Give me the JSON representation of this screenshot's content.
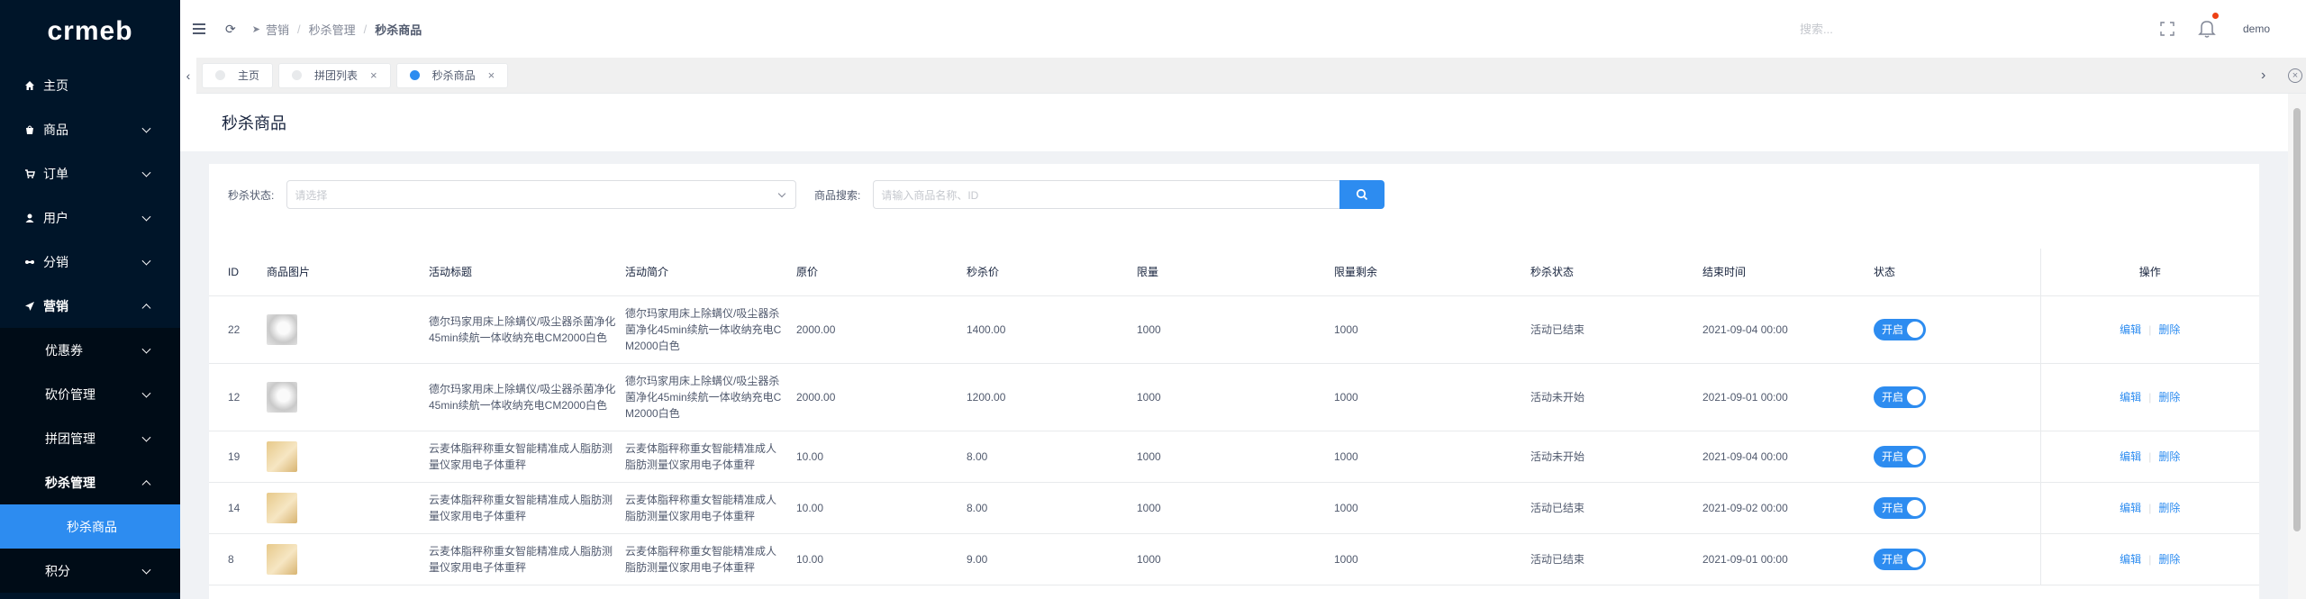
{
  "logo": "crmeb",
  "sidebar": {
    "items": [
      {
        "label": "主页",
        "icon": "home-icon"
      },
      {
        "label": "商品",
        "icon": "goods-icon"
      },
      {
        "label": "订单",
        "icon": "cart-icon"
      },
      {
        "label": "用户",
        "icon": "user-icon"
      },
      {
        "label": "分销",
        "icon": "distribution-icon"
      },
      {
        "label": "营销",
        "icon": "send-icon"
      }
    ],
    "marketing_children": [
      {
        "label": "优惠券"
      },
      {
        "label": "砍价管理"
      },
      {
        "label": "拼团管理"
      },
      {
        "label": "秒杀管理"
      }
    ],
    "seckill_children": [
      {
        "label": "秒杀商品"
      }
    ],
    "bottom": {
      "label": "积分"
    }
  },
  "header": {
    "breadcrumb": [
      "营销",
      "秒杀管理",
      "秒杀商品"
    ],
    "search_placeholder": "搜索...",
    "username": "demo"
  },
  "tabs": [
    {
      "label": "主页",
      "closable": false,
      "active": false
    },
    {
      "label": "拼团列表",
      "closable": true,
      "active": false
    },
    {
      "label": "秒杀商品",
      "closable": true,
      "active": true
    }
  ],
  "page_title": "秒杀商品",
  "filters": {
    "status_label": "秒杀状态:",
    "status_placeholder": "请选择",
    "search_label": "商品搜索:",
    "search_placeholder": "请输入商品名称、ID"
  },
  "table": {
    "columns": [
      "ID",
      "商品图片",
      "活动标题",
      "活动简介",
      "原价",
      "秒杀价",
      "限量",
      "限量剩余",
      "秒杀状态",
      "结束时间",
      "状态",
      "操作"
    ],
    "rows": [
      {
        "id": "22",
        "img": "w",
        "title": [
          "德尔玛家用床上除螨仪/吸尘器杀菌净化",
          "45min续航一体收纳充电CM2000白色"
        ],
        "intro": [
          "德尔玛家用床上除螨仪/吸尘器杀",
          "菌净化45min续航一体收纳充电C",
          "M2000白色"
        ],
        "price": "2000.00",
        "seckill_price": "1400.00",
        "quota": "1000",
        "quota_left": "1000",
        "seckill_status": "活动已结束",
        "end_time": "2021-09-04 00:00",
        "status": "开启",
        "edit": "编辑",
        "delete": "删除"
      },
      {
        "id": "12",
        "img": "w",
        "title": [
          "德尔玛家用床上除螨仪/吸尘器杀菌净化",
          "45min续航一体收纳充电CM2000白色"
        ],
        "intro": [
          "德尔玛家用床上除螨仪/吸尘器杀",
          "菌净化45min续航一体收纳充电C",
          "M2000白色"
        ],
        "price": "2000.00",
        "seckill_price": "1200.00",
        "quota": "1000",
        "quota_left": "1000",
        "seckill_status": "活动未开始",
        "end_time": "2021-09-01 00:00",
        "status": "开启",
        "edit": "编辑",
        "delete": "删除"
      },
      {
        "id": "19",
        "img": "y",
        "title": [
          "云麦体脂秤称重女智能精准成人脂肪测",
          "量仪家用电子体重秤"
        ],
        "intro": [
          "云麦体脂秤称重女智能精准成人",
          "脂肪测量仪家用电子体重秤"
        ],
        "price": "10.00",
        "seckill_price": "8.00",
        "quota": "1000",
        "quota_left": "1000",
        "seckill_status": "活动未开始",
        "end_time": "2021-09-04 00:00",
        "status": "开启",
        "edit": "编辑",
        "delete": "删除"
      },
      {
        "id": "14",
        "img": "y",
        "title": [
          "云麦体脂秤称重女智能精准成人脂肪测",
          "量仪家用电子体重秤"
        ],
        "intro": [
          "云麦体脂秤称重女智能精准成人",
          "脂肪测量仪家用电子体重秤"
        ],
        "price": "10.00",
        "seckill_price": "8.00",
        "quota": "1000",
        "quota_left": "1000",
        "seckill_status": "活动已结束",
        "end_time": "2021-09-02 00:00",
        "status": "开启",
        "edit": "编辑",
        "delete": "删除"
      },
      {
        "id": "8",
        "img": "y",
        "title": [
          "云麦体脂秤称重女智能精准成人脂肪测",
          "量仪家用电子体重秤"
        ],
        "intro": [
          "云麦体脂秤称重女智能精准成人",
          "脂肪测量仪家用电子体重秤"
        ],
        "price": "10.00",
        "seckill_price": "9.00",
        "quota": "1000",
        "quota_left": "1000",
        "seckill_status": "活动已结束",
        "end_time": "2021-09-01 00:00",
        "status": "开启",
        "edit": "编辑",
        "delete": "删除"
      }
    ]
  },
  "colors": {
    "primary": "#2d8cf0",
    "sidebar": "#001529",
    "submenu": "#000c17"
  }
}
